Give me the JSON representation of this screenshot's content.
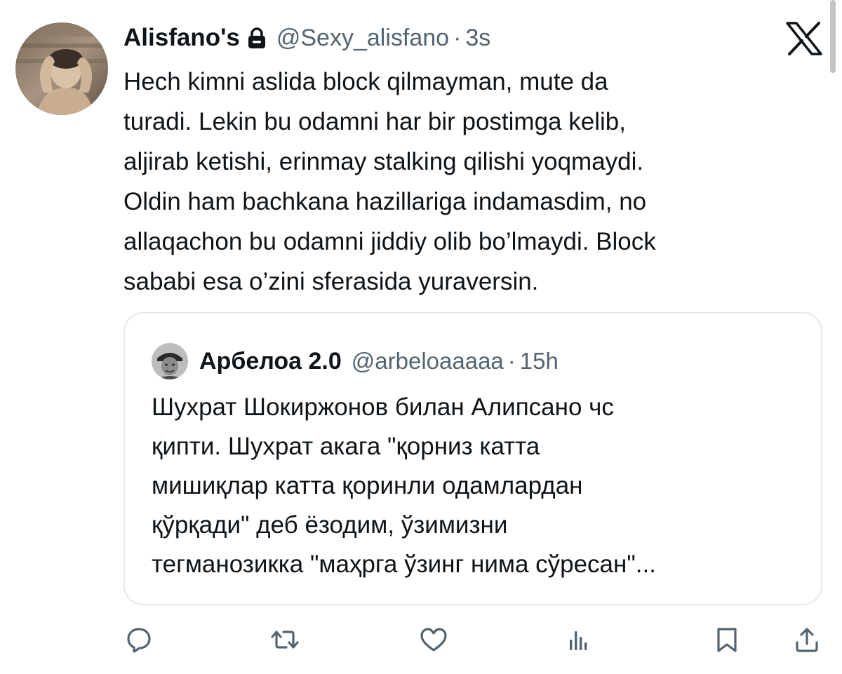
{
  "tweet": {
    "display_name": "Alisfano's",
    "handle": "@Sexy_alisfano",
    "separator": "·",
    "time": "3s",
    "lines": [
      "Hech kimni aslida block qilmayman, mute da",
      "turadi. Lekin bu odamni har bir postimga kelib,",
      "aljirab ketishi, erinmay stalking qilishi yoqmaydi.",
      "Oldin ham bachkana hazillariga indamasdim, no",
      "allaqachon bu odamni jiddiy olib bo’lmaydi. Block",
      "sababi esa o’zini sferasida yuraversin."
    ]
  },
  "quote": {
    "display_name": "Арбелоа 2.0",
    "handle": "@arbeloaaaaa",
    "separator": "·",
    "time": "15h",
    "lines": [
      "Шухрат Шокиржонов билан Алипсано чс",
      "қипти. Шухрат акага \"қорниз катта",
      "мишиқлар катта қоринли одамлардан",
      "қўрқади\" деб ёзодим, ўзимизни",
      "тегманозикка \"маҳрга ўзинг нима сўресан\"..."
    ]
  },
  "icons": {
    "protected": "lock-icon",
    "brand": "x-logo-icon",
    "actions": [
      "reply-icon",
      "retweet-icon",
      "like-icon",
      "views-icon",
      "bookmark-icon",
      "share-icon"
    ]
  },
  "colors": {
    "text": "#0f1419",
    "secondary_text": "#536471",
    "border": "#e4e8eb",
    "icon": "#536471"
  }
}
